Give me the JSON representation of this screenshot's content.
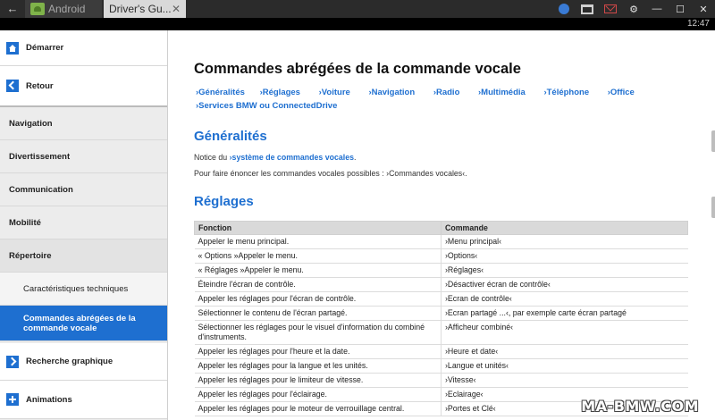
{
  "window": {
    "back_glyph": "←",
    "tabs": [
      {
        "label": "Android"
      },
      {
        "label": "Driver's Gu...",
        "close": "✕"
      }
    ],
    "controls": {
      "minimize": "—",
      "maximize": "☐",
      "close": "✕",
      "settings": "⚙"
    },
    "clock": "12:47"
  },
  "sidebar": {
    "items": [
      {
        "label": "Démarrer",
        "icon": "home-icon"
      },
      {
        "label": "Retour",
        "icon": "back-icon"
      },
      {
        "label": "Navigation"
      },
      {
        "label": "Divertissement"
      },
      {
        "label": "Communication"
      },
      {
        "label": "Mobilité"
      },
      {
        "label": "Répertoire"
      },
      {
        "label": "Caractéristiques techniques"
      },
      {
        "label": "Commandes abrégées de la commande vocale"
      },
      {
        "label": "Recherche graphique",
        "icon": "forward-icon"
      },
      {
        "label": "Animations",
        "icon": "plus-icon"
      }
    ],
    "accent": "#1e6fd0"
  },
  "main": {
    "title": "Commandes abrégées de la commande vocale",
    "links": [
      "›Généralités",
      "›Réglages",
      "›Voiture",
      "›Navigation",
      "›Radio",
      "›Multimédia",
      "›Téléphone",
      "›Office",
      "›Services BMW ou ConnectedDrive"
    ],
    "generalites": {
      "title": "Généralités",
      "notice_prefix": "Notice du",
      "notice_link": "›système de commandes vocales",
      "notice_suffix": ".",
      "para2": "Pour faire énoncer les commandes vocales possibles : ›Commandes vocales‹."
    },
    "reglages": {
      "title": "Réglages",
      "columns": [
        "Fonction",
        "Commande"
      ],
      "rows": [
        [
          "Appeler le menu principal.",
          "›Menu principal‹"
        ],
        [
          "« Options »Appeler le menu.",
          "›Options‹"
        ],
        [
          "« Réglages »Appeler le menu.",
          "›Réglages‹"
        ],
        [
          "Éteindre l'écran de contrôle.",
          "›Désactiver écran de contrôle‹"
        ],
        [
          "Appeler les réglages pour l'écran de contrôle.",
          "›Ecran de contrôle‹"
        ],
        [
          "Sélectionner le contenu de l'écran partagé.",
          "›Ecran partagé ...‹, par exemple carte écran partagé"
        ],
        [
          "Sélectionner les réglages pour le visuel d'information du combiné d'instruments.",
          "›Afficheur combiné‹"
        ],
        [
          "Appeler les réglages pour l'heure et la date.",
          "›Heure et date‹"
        ],
        [
          "Appeler les réglages pour la langue et les unités.",
          "›Langue et unités‹"
        ],
        [
          "Appeler les réglages pour le limiteur de vitesse.",
          "›Vitesse‹"
        ],
        [
          "Appeler les réglages pour l'éclairage.",
          "›Eclairage‹"
        ],
        [
          "Appeler les réglages pour le moteur de verrouillage central.",
          "›Portes et Clé‹"
        ]
      ]
    }
  },
  "watermark": "MA-BMW.COM"
}
